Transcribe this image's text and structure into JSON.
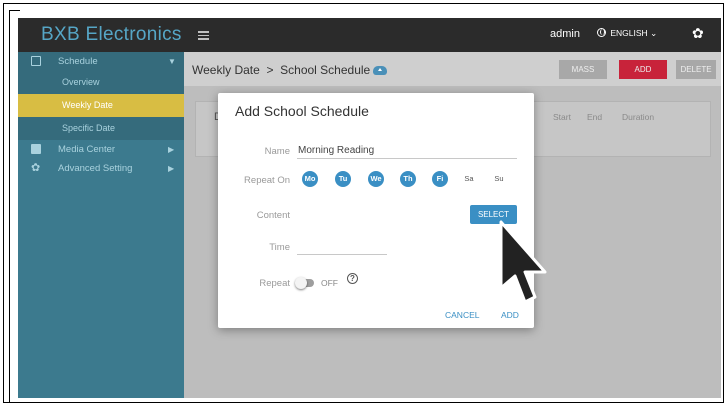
{
  "brand": "BXB Electronics",
  "sidebar": {
    "schedule": "Schedule",
    "sub": [
      "Overview",
      "Weekly Date",
      "Specific Date"
    ],
    "media": "Media Center",
    "advanced": "Advanced Setting"
  },
  "topbar": {
    "user": "admin",
    "language": "ENGLISH"
  },
  "breadcrumb": "Weekly Date  >  School Schedule",
  "toolbar": {
    "mass": "MASS",
    "add": "ADD",
    "delete": "DELETE"
  },
  "panel": {
    "first_letter": "D",
    "columns": [
      "Start",
      "End",
      "Duration"
    ]
  },
  "dialog": {
    "title": "Add School Schedule",
    "name_label": "Name",
    "name_value": "Morning Reading",
    "repeat_on_label": "Repeat On",
    "days": [
      {
        "label": "Mo",
        "on": true
      },
      {
        "label": "Tu",
        "on": true
      },
      {
        "label": "We",
        "on": true
      },
      {
        "label": "Th",
        "on": true
      },
      {
        "label": "Fi",
        "on": true
      },
      {
        "label": "Sa",
        "on": false
      },
      {
        "label": "Su",
        "on": false
      }
    ],
    "content_label": "Content",
    "select_label": "SELECT",
    "time_label": "Time",
    "repeat_label": "Repeat",
    "repeat_state": "OFF",
    "help_glyph": "?",
    "cancel": "CANCEL",
    "add": "ADD"
  },
  "colors": {
    "accent": "#3a8fc4",
    "danger": "#c8233a",
    "sidebar": "#3c7a8e",
    "active": "#d8bd43"
  },
  "icons": [
    "menu-icon",
    "globe-icon",
    "chevron-down-icon",
    "gear-icon",
    "cloud-upload-icon",
    "calendar-icon",
    "folder-icon",
    "help-icon",
    "cursor-arrow-icon"
  ]
}
